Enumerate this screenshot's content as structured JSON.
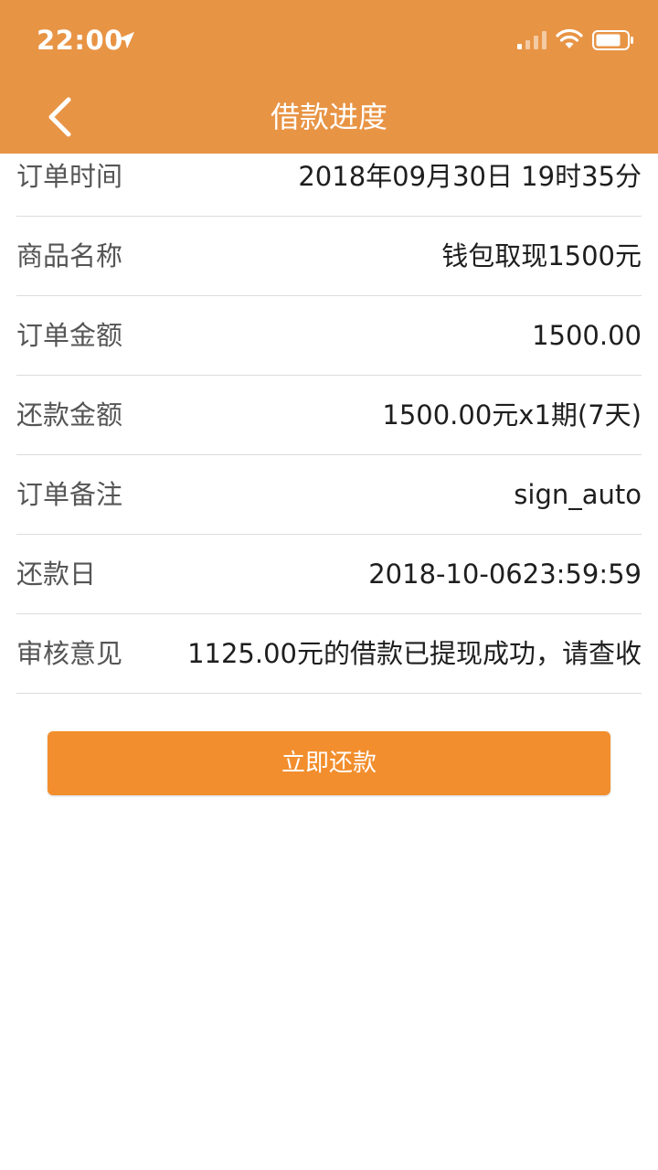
{
  "status_bar": {
    "time": "22:00",
    "icons": [
      "location-arrow-icon",
      "cellular-signal-icon",
      "wifi-icon",
      "battery-icon"
    ]
  },
  "nav": {
    "title": "借款进度",
    "back_icon": "chevron-left-icon"
  },
  "details": [
    {
      "label": "订单时间",
      "value": "2018年09月30日 19时35分"
    },
    {
      "label": "商品名称",
      "value": "钱包取现1500元"
    },
    {
      "label": "订单金额",
      "value": "1500.00"
    },
    {
      "label": "还款金额",
      "value": "1500.00元x1期(7天)"
    },
    {
      "label": "订单备注",
      "value": "sign_auto"
    },
    {
      "label": "还款日",
      "value": "2018-10-0623:59:59"
    },
    {
      "label": "审核意见",
      "value": "1125.00元的借款已提现成功，请查收"
    }
  ],
  "action": {
    "repay_label": "立即还款"
  },
  "colors": {
    "header_bg": "#E89445",
    "button_bg": "#F28E2D",
    "divider": "#DCDCDC"
  }
}
